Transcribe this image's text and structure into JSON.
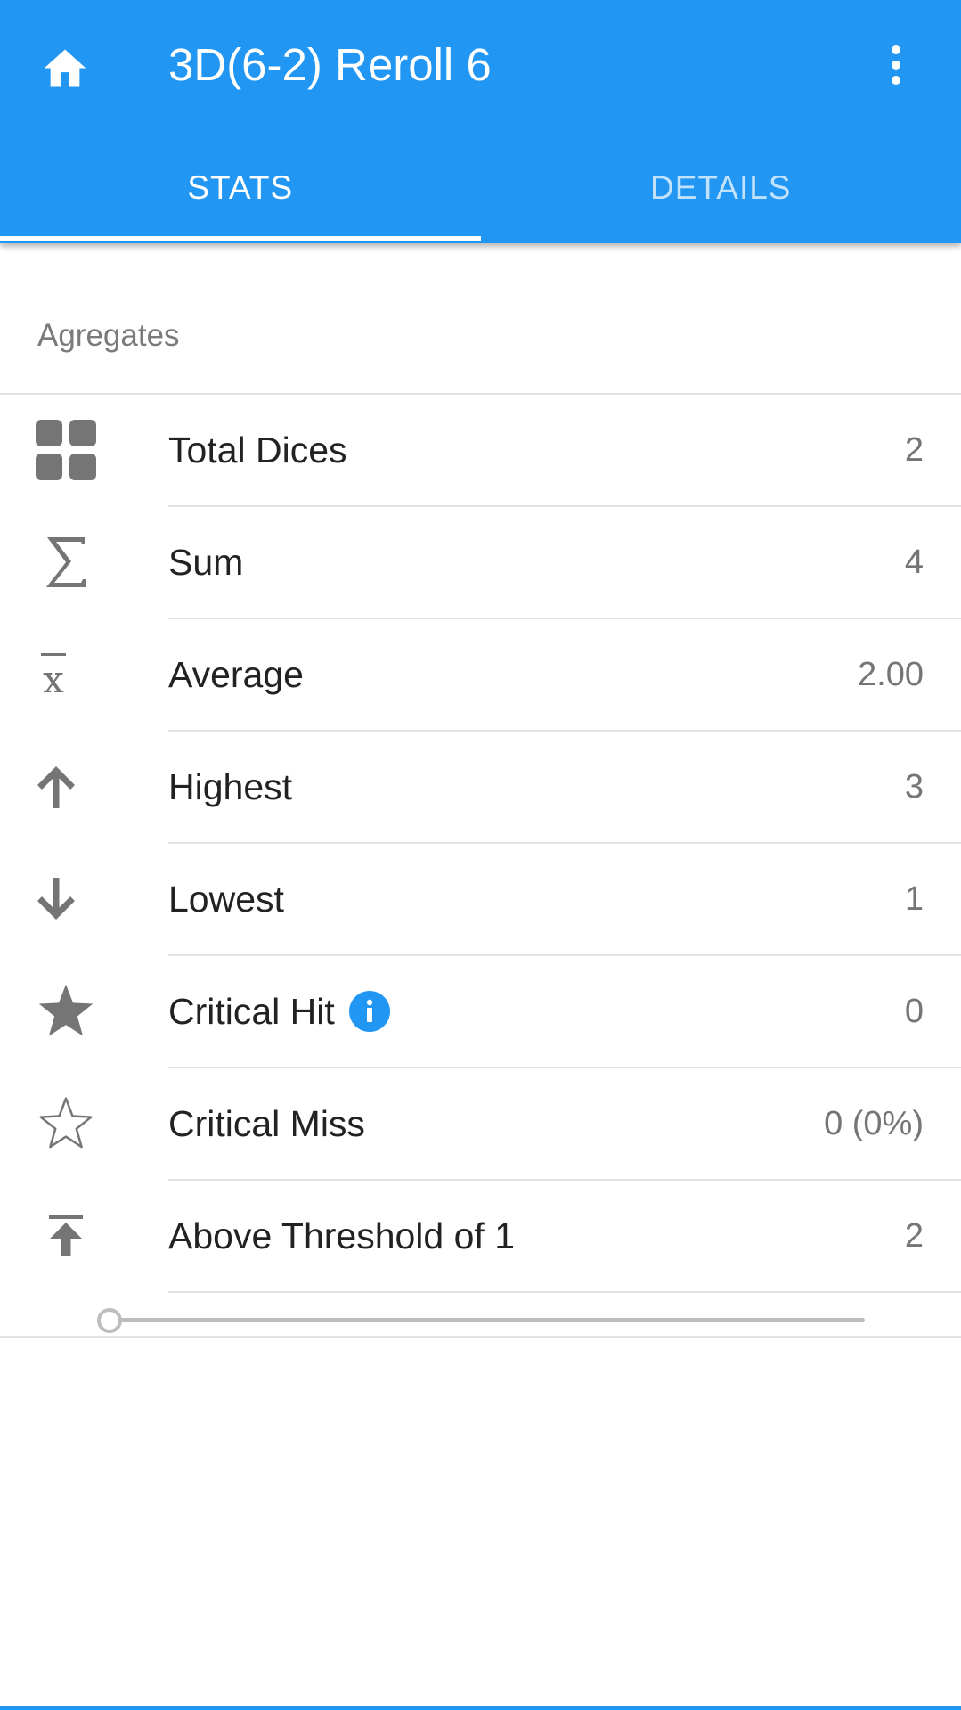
{
  "app_bar": {
    "title": "3D(6-2) Reroll 6",
    "home_icon": "home-icon",
    "menu_icon": "more-vert-icon"
  },
  "tabs": [
    {
      "label": "STATS",
      "active": true
    },
    {
      "label": "DETAILS",
      "active": false
    }
  ],
  "section": {
    "header": "Agregates"
  },
  "rows": [
    {
      "icon": "grid-icon",
      "label": "Total Dices",
      "value": "2"
    },
    {
      "icon": "sigma-icon",
      "label": "Sum",
      "value": "4"
    },
    {
      "icon": "mean-icon",
      "label": "Average",
      "value": "2.00"
    },
    {
      "icon": "arrow-up-icon",
      "label": "Highest",
      "value": "3"
    },
    {
      "icon": "arrow-down-icon",
      "label": "Lowest",
      "value": "1"
    },
    {
      "icon": "star-filled-icon",
      "label": "Critical Hit",
      "value": "0",
      "info_icon": "info-icon"
    },
    {
      "icon": "star-outline-icon",
      "label": "Critical Miss",
      "value": "0 (0%)"
    },
    {
      "icon": "vertical-align-top-icon",
      "label": "Above Threshold of 1",
      "value": "2"
    }
  ],
  "threshold_slider": {
    "value_fraction": 0
  },
  "colors": {
    "primary": "#2196f3",
    "icon_gray": "#757575",
    "divider": "#e2e2e2",
    "text": "#222222"
  }
}
